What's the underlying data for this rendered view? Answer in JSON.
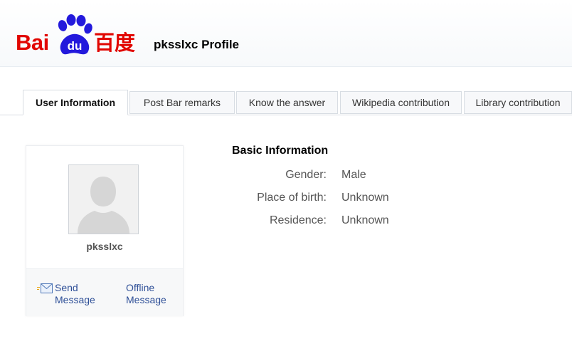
{
  "header": {
    "logo_latin": "Bai",
    "logo_paw_text": "du",
    "logo_chinese": "百度",
    "title": "pksslxc Profile"
  },
  "tabs": [
    {
      "label": "User Information",
      "active": true
    },
    {
      "label": "Post Bar remarks",
      "active": false
    },
    {
      "label": "Know the answer",
      "active": false
    },
    {
      "label": "Wikipedia contribution",
      "active": false
    },
    {
      "label": "Library contribution",
      "active": false
    }
  ],
  "card": {
    "username": "pksslxc",
    "send_message": "Send Message",
    "offline_message": "Offline Message"
  },
  "info": {
    "title": "Basic Information",
    "rows": [
      {
        "label": "Gender:",
        "value": "Male"
      },
      {
        "label": "Place of birth:",
        "value": "Unknown"
      },
      {
        "label": "Residence:",
        "value": "Unknown"
      }
    ]
  },
  "colors": {
    "brand_red": "#e10601",
    "brand_blue": "#2319dc",
    "link_blue": "#2e4f97"
  },
  "icons": {
    "logo_paw": "baidu-paw-icon",
    "mail": "envelope-icon",
    "avatar": "default-avatar-silhouette"
  }
}
